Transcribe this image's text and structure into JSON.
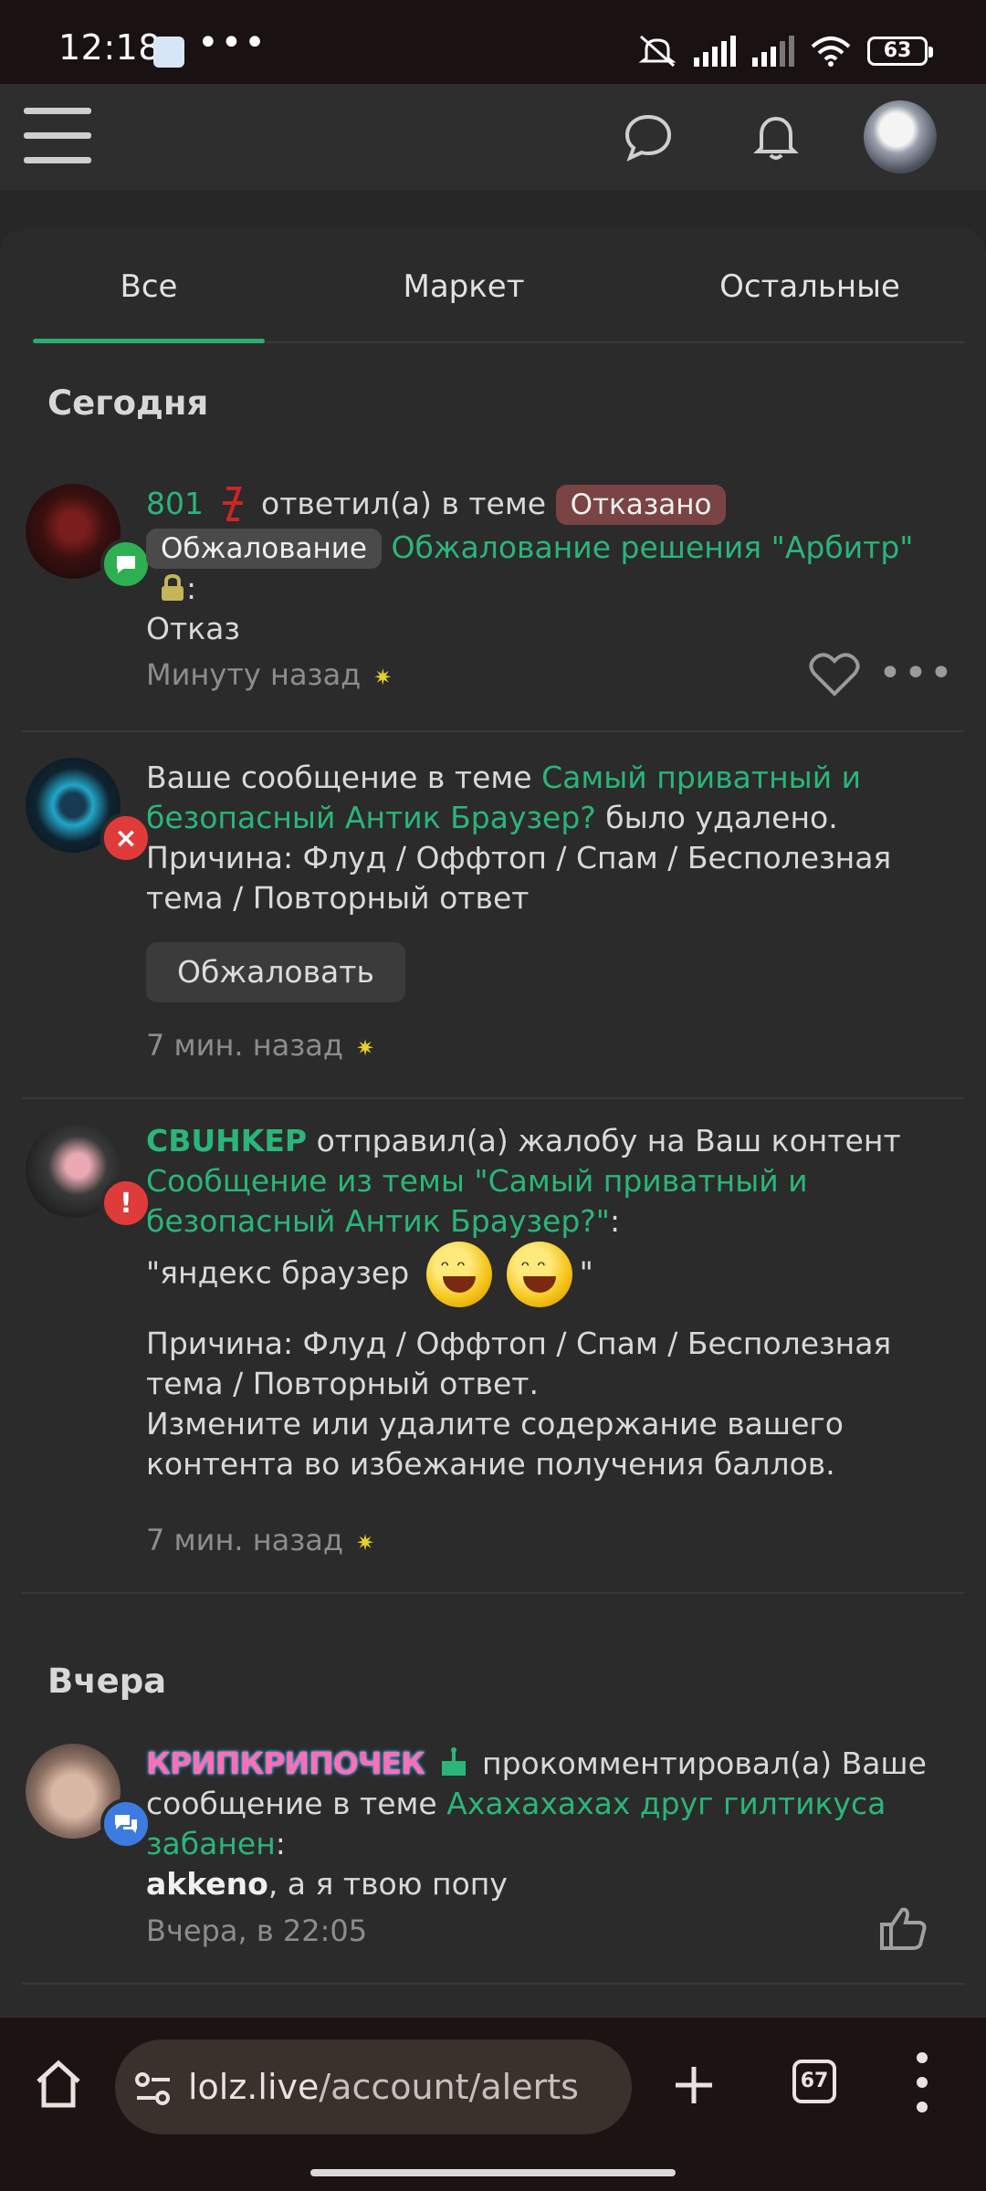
{
  "status_bar": {
    "time": "12:18",
    "dots": "•••",
    "battery": "63"
  },
  "header": {
    "menu_icon": "hamburger-icon",
    "chat_icon": "chat-bubble-icon",
    "bell_icon": "bell-icon"
  },
  "tabs": [
    "Все",
    "Маркет",
    "Остальные"
  ],
  "sections": {
    "today": "Сегодня",
    "yesterday": "Вчера"
  },
  "alerts": [
    {
      "user": "801",
      "verb": "ответил(а) в теме",
      "status_tag": "Отказано",
      "prefix_tag": "Обжалование",
      "thread": "Обжалование решения \"Арбитр\"",
      "colon": ":",
      "body": "Отказ",
      "time": "Минуту назад"
    },
    {
      "pre": "Ваше сообщение в теме",
      "thread": "Самый приватный и безопасный Антик Браузер?",
      "post": "было удалено.",
      "reason": "Причина: Флуд / Оффтоп / Спам / Бесполезная тема / Повторный ответ",
      "button": "Обжаловать",
      "time": "7 мин. назад"
    },
    {
      "user": "CBUHKEP",
      "verb": "отправил(а) жалобу на Ваш контент",
      "thread": "Сообщение из темы \"Самый приватный и безопасный Антик Браузер?\"",
      "colon": ":",
      "quote_open": "\"яндекс браузер",
      "quote_close": "\"",
      "reason": "Причина: Флуд / Оффтоп / Спам / Бесполезная тема / Повторный ответ.",
      "advice": "Измените или удалите содержание вашего контента во избежание получения баллов.",
      "time": "7 мин. назад"
    },
    {
      "user": "КРИПКРИПОЧЕК",
      "verb": "прокомментировал(а) Ваше сообщение в теме",
      "thread": "Ахахахахах друг гилтикуса забанен",
      "colon": ":",
      "comment_user": "akkeno",
      "comment": ", а я твою попу",
      "time": "Вчера, в 22:05"
    }
  ],
  "browser": {
    "url_host": "lolz.live",
    "url_path": "/account/alerts",
    "tab_count": "67"
  }
}
